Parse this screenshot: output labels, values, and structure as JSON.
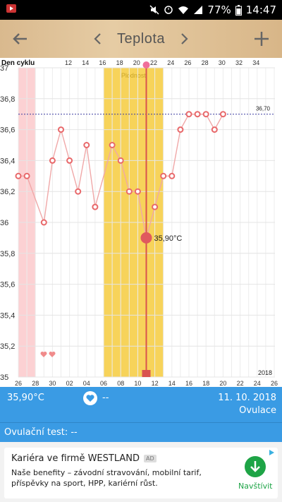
{
  "status_bar": {
    "battery_percent": "77%",
    "time": "14:47"
  },
  "app_bar": {
    "title": "Teplota",
    "back_icon": "arrow-left-icon",
    "add_icon": "plus-icon"
  },
  "chart_data": {
    "type": "line",
    "xlabel": "Den cyklu",
    "top_ticks": [
      "12",
      "14",
      "16",
      "18",
      "20",
      "22",
      "24",
      "26",
      "28",
      "30",
      "32",
      "34"
    ],
    "bottom_ticks": [
      "26",
      "28",
      "30",
      "02",
      "04",
      "06",
      "08",
      "10",
      "12",
      "14",
      "16",
      "18",
      "20",
      "22",
      "24",
      "26"
    ],
    "y_ticks": [
      "37",
      "36,8",
      "36,6",
      "36,4",
      "36,2",
      "36",
      "35,8",
      "35,6",
      "35,4",
      "35,2",
      "35"
    ],
    "ylim": [
      35,
      37
    ],
    "cover_line": {
      "value": 36.7,
      "label": "36,70"
    },
    "fertile_label": "Plodnost",
    "year_label": "2018",
    "selected_label": "35,90°C",
    "series": [
      {
        "values": [
          36.3,
          36.3,
          null,
          36.0,
          36.4,
          36.6,
          36.4,
          36.2,
          36.5,
          36.1,
          null,
          36.5,
          36.4,
          36.2,
          36.2,
          35.9,
          36.1,
          36.3,
          36.3,
          36.6,
          36.7,
          36.7,
          36.7,
          36.6,
          36.7
        ],
        "color": "#f0a8a8"
      }
    ],
    "colors": {
      "line": "#f0a8a8",
      "marker_edge": "#e8686a",
      "fertile": "#f7d35a",
      "period": "#fcd1d3",
      "ovulation": "#d9534f",
      "cover": "#3a3aa0"
    }
  },
  "info_bar": {
    "temperature": "35,90°C",
    "heart_value": "--",
    "date": "11. 10. 2018",
    "event": "Ovulace"
  },
  "test_bar": {
    "label": "Ovulační test: --"
  },
  "ad": {
    "title": "Kariéra ve firmě WESTLAND",
    "badge": "AD",
    "description": "Naše benefity – závodní stravování, mobilní tarif, příspěvky na sport, HPP, kariérní růst.",
    "action": "Navštívit"
  }
}
